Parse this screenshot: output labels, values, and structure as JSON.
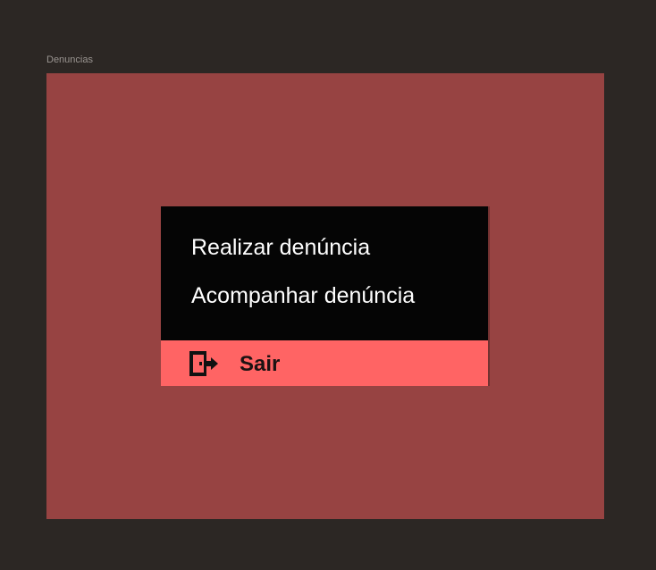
{
  "frame": {
    "label": "Denuncias"
  },
  "menu": {
    "items": [
      {
        "label": "Realizar denúncia"
      },
      {
        "label": "Acompanhar denúncia"
      }
    ],
    "exit": {
      "label": "Sair",
      "icon": "exit-door-icon"
    }
  },
  "colors": {
    "canvas_background": "#2c2724",
    "frame_background": "#974342",
    "menu_background": "#050505",
    "menu_text": "#ffffff",
    "exit_background": "#ff6464",
    "exit_text": "#1b1212"
  }
}
